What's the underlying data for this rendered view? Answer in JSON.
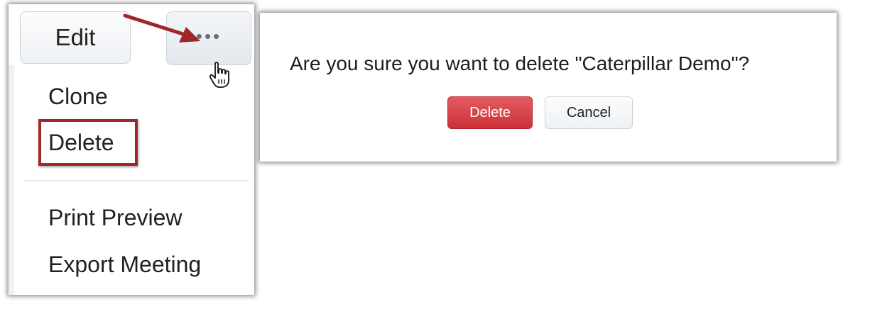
{
  "menu": {
    "edit_label": "Edit",
    "more_label": "•••",
    "items": [
      {
        "label": "Clone"
      },
      {
        "label": "Delete"
      },
      {
        "label": "Print Preview"
      },
      {
        "label": "Export Meeting"
      }
    ],
    "highlight_color": "#a0262a",
    "arrow_color": "#a0262a"
  },
  "dialog": {
    "question": "Are you sure you want to delete \"Caterpillar Demo\"?",
    "delete_label": "Delete",
    "cancel_label": "Cancel",
    "delete_color": "#d9434a"
  },
  "icons": {
    "more": "more-options-icon",
    "cursor": "hand-pointer-icon",
    "arrow": "annotation-arrow-icon"
  }
}
